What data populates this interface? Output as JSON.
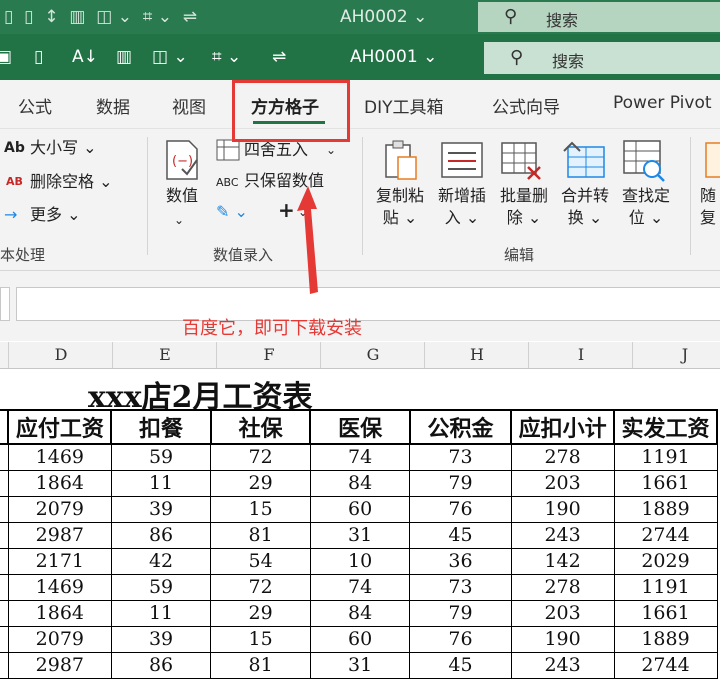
{
  "ghost_bar": {
    "doc_name": "AH0002 ⌄",
    "search_label": "搜索"
  },
  "title_bar": {
    "doc_name": "AH0001 ⌄",
    "search_label": "搜索"
  },
  "tabs": [
    "公式",
    "数据",
    "视图",
    "方方格子",
    "DIY工具箱",
    "公式向导",
    "Power Pivot"
  ],
  "ribbon": {
    "text_group": {
      "items": [
        "大小写 ⌄",
        "删除空格 ⌄",
        "更多 ⌄"
      ],
      "icons": [
        "Ab",
        "AB"
      ],
      "group_label": "本处理"
    },
    "number_group": {
      "value_button": "数值",
      "round_label": "四舍五入",
      "keep_value_label": "只保留数值",
      "abc_icon": "ABC",
      "group_label": "数值录入"
    },
    "edit_group": {
      "buttons": [
        {
          "line1": "复制粘",
          "line2": "贴 ⌄"
        },
        {
          "line1": "新增插",
          "line2": "入 ⌄"
        },
        {
          "line1": "批量删",
          "line2": "除 ⌄"
        },
        {
          "line1": "合并转",
          "line2": "换 ⌄"
        },
        {
          "line1": "查找定",
          "line2": "位 ⌄"
        },
        {
          "line1": "随",
          "line2": "复"
        }
      ],
      "group_label": "编辑"
    }
  },
  "annotation": "百度它，即可下载安装",
  "column_headers": [
    "D",
    "E",
    "F",
    "G",
    "H",
    "I",
    "J"
  ],
  "sheet": {
    "title": "xxx店2月工资表",
    "headers": [
      "应付工资",
      "扣餐",
      "社保",
      "医保",
      "公积金",
      "应扣小计",
      "实发工资"
    ],
    "rows": [
      [
        "1469",
        "59",
        "72",
        "74",
        "73",
        "278",
        "1191"
      ],
      [
        "1864",
        "11",
        "29",
        "84",
        "79",
        "203",
        "1661"
      ],
      [
        "2079",
        "39",
        "15",
        "60",
        "76",
        "190",
        "1889"
      ],
      [
        "2987",
        "86",
        "81",
        "31",
        "45",
        "243",
        "2744"
      ],
      [
        "2171",
        "42",
        "54",
        "10",
        "36",
        "142",
        "2029"
      ],
      [
        "1469",
        "59",
        "72",
        "74",
        "73",
        "278",
        "1191"
      ],
      [
        "1864",
        "11",
        "29",
        "84",
        "79",
        "203",
        "1661"
      ],
      [
        "2079",
        "39",
        "15",
        "60",
        "76",
        "190",
        "1889"
      ],
      [
        "2987",
        "86",
        "81",
        "31",
        "45",
        "243",
        "2744"
      ]
    ]
  },
  "colors": {
    "excel_green": "#217346",
    "highlight_red": "#e53935"
  }
}
